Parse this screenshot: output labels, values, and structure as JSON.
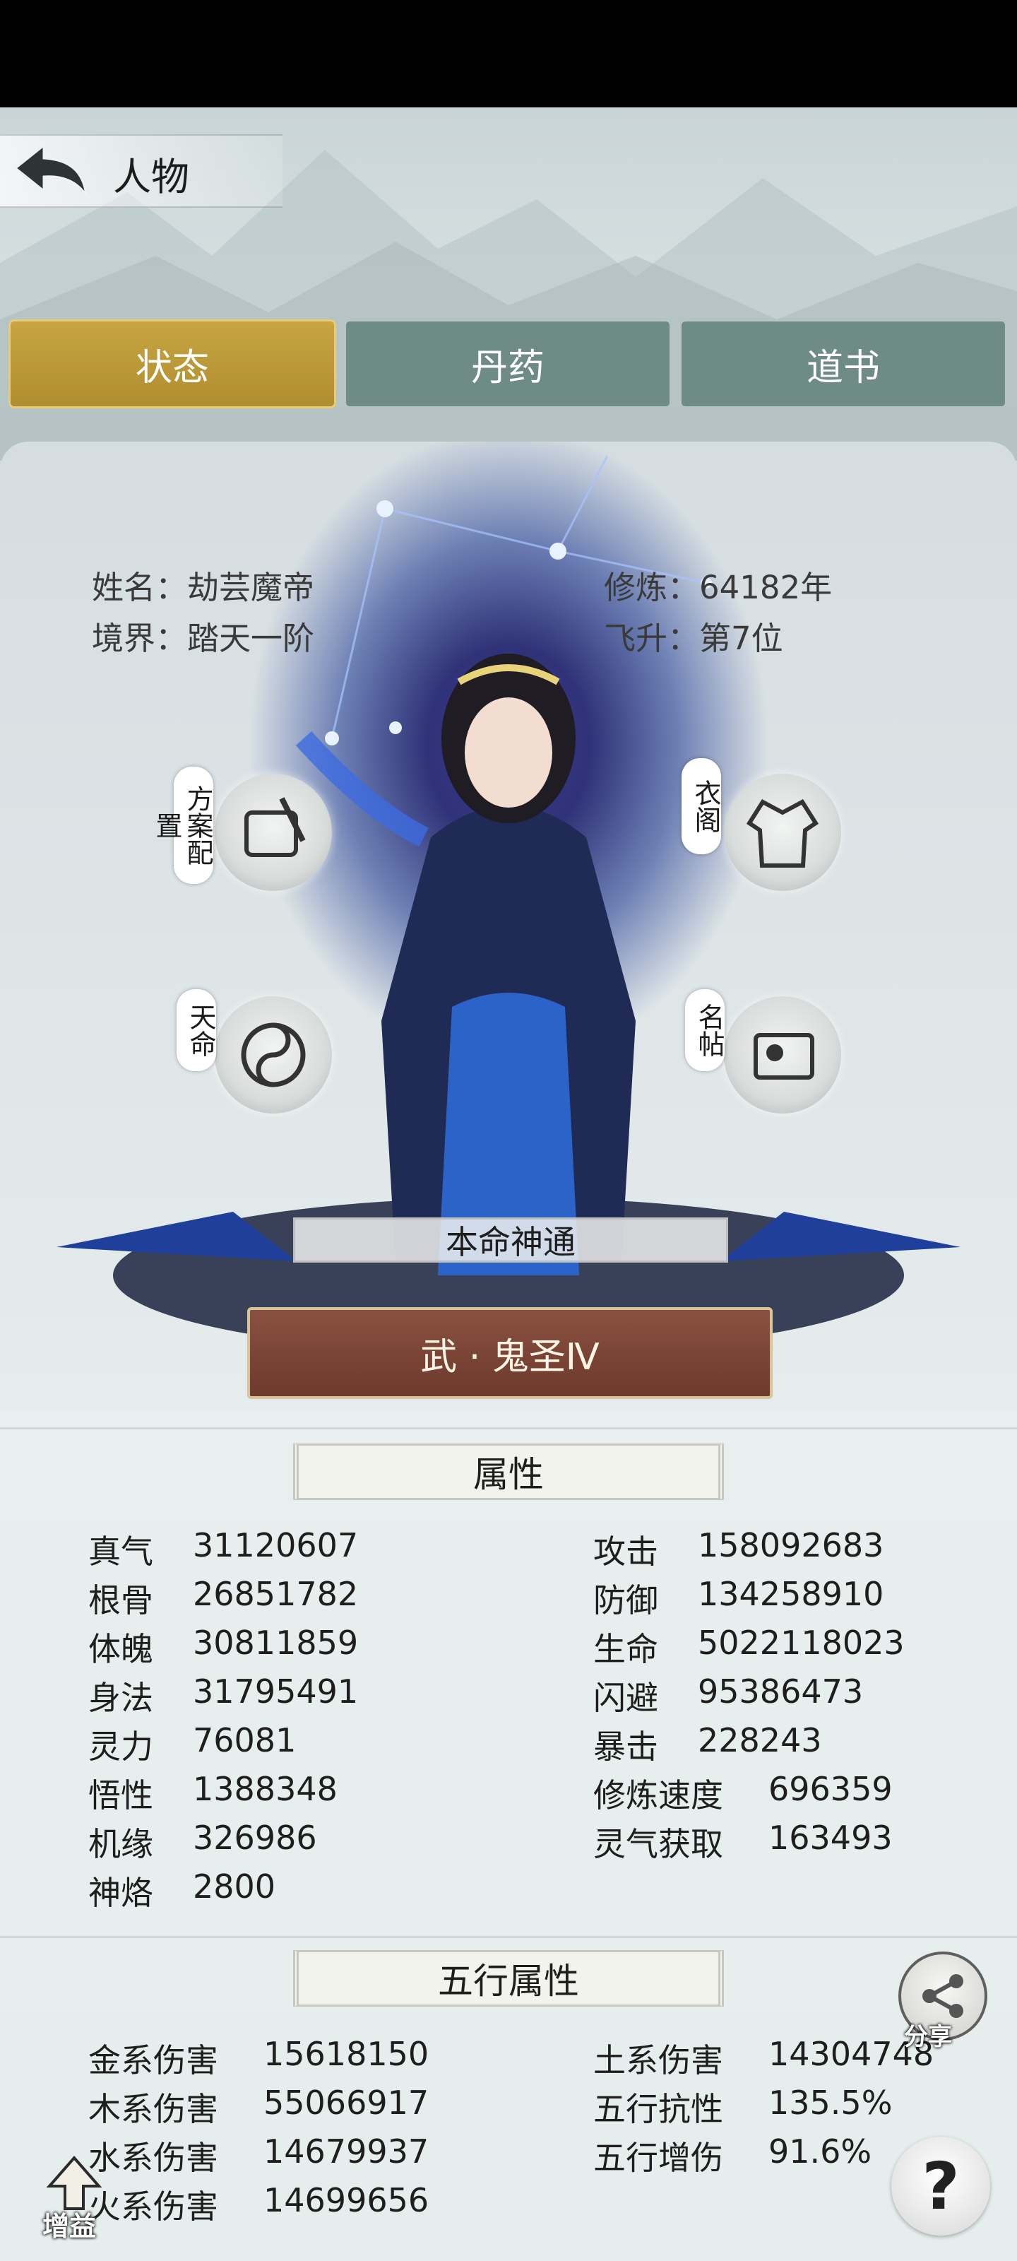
{
  "header": {
    "title": "人物"
  },
  "tabs": [
    {
      "label": "状态",
      "active": true
    },
    {
      "label": "丹药",
      "active": false
    },
    {
      "label": "道书",
      "active": false
    }
  ],
  "profile": {
    "name_key": "姓名：",
    "name": "劫芸魔帝",
    "realm_key": "境界：",
    "realm": "踏天一阶",
    "cultivation_key": "修炼：",
    "cultivation": "64182年",
    "ascension_key": "飞升：",
    "ascension": "第7位"
  },
  "side_buttons": {
    "plan": "方案配置",
    "wardrobe": "衣阁",
    "fate": "天命",
    "namecard": "名帖"
  },
  "innate": {
    "banner": "本命神通",
    "rank": "武 · 鬼圣Ⅳ"
  },
  "attributes": {
    "title": "属性",
    "left": [
      {
        "label": "真气",
        "value": "31120607"
      },
      {
        "label": "根骨",
        "value": "26851782"
      },
      {
        "label": "体魄",
        "value": "30811859"
      },
      {
        "label": "身法",
        "value": "31795491"
      },
      {
        "label": "灵力",
        "value": "76081"
      },
      {
        "label": "悟性",
        "value": "1388348"
      },
      {
        "label": "机缘",
        "value": "326986"
      },
      {
        "label": "神烙",
        "value": "2800"
      }
    ],
    "right": [
      {
        "label": "攻击",
        "value": "158092683"
      },
      {
        "label": "防御",
        "value": "134258910"
      },
      {
        "label": "生命",
        "value": "5022118023"
      },
      {
        "label": "闪避",
        "value": "95386473"
      },
      {
        "label": "暴击",
        "value": "228243"
      },
      {
        "label": "修炼速度",
        "value": "696359"
      },
      {
        "label": "灵气获取",
        "value": "163493"
      }
    ]
  },
  "elements": {
    "title": "五行属性",
    "left": [
      {
        "label": "金系伤害",
        "value": "15618150"
      },
      {
        "label": "木系伤害",
        "value": "55066917"
      },
      {
        "label": "水系伤害",
        "value": "14679937"
      },
      {
        "label": "火系伤害",
        "value": "14699656"
      }
    ],
    "right": [
      {
        "label": "土系伤害",
        "value": "14304748"
      },
      {
        "label": "五行抗性",
        "value": "135.5%"
      },
      {
        "label": "五行增伤",
        "value": "91.6%"
      }
    ]
  },
  "floating": {
    "share": "分享",
    "help": "?",
    "buff": "增益"
  },
  "colors": {
    "active_tab": "#c8a542",
    "tab": "#6f8b86",
    "rank_plate": "#7a4535"
  }
}
